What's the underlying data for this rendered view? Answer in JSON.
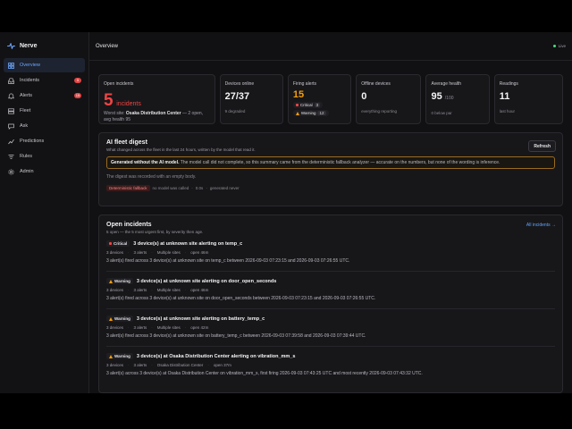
{
  "app": {
    "name": "Nerve"
  },
  "sidebar": {
    "items": [
      {
        "label": "Overview",
        "icon": "grid-icon",
        "active": true,
        "badge": ""
      },
      {
        "label": "Incidents",
        "icon": "inbox-icon",
        "active": false,
        "badge": "5"
      },
      {
        "label": "Alerts",
        "icon": "bell-icon",
        "active": false,
        "badge": "15"
      },
      {
        "label": "Fleet",
        "icon": "server-icon",
        "active": false,
        "badge": ""
      },
      {
        "label": "Ask",
        "icon": "chat-icon",
        "active": false,
        "badge": ""
      },
      {
        "label": "Predictions",
        "icon": "trend-icon",
        "active": false,
        "badge": ""
      },
      {
        "label": "Rules",
        "icon": "rules-icon",
        "active": false,
        "badge": ""
      },
      {
        "label": "Admin",
        "icon": "gear-icon",
        "active": false,
        "badge": ""
      }
    ]
  },
  "header": {
    "title": "Overview",
    "live_label": "Live"
  },
  "stats": {
    "open_incidents": {
      "label": "Open incidents",
      "value": "5",
      "word": "incidents",
      "worst_prefix": "Worst site: ",
      "worst_site": "Osaka Distribution Center",
      "worst_suffix": " — 2 open,",
      "worst_line2": "avg health 95"
    },
    "devices_online": {
      "label": "Devices online",
      "value": "27/37",
      "sub": "9 degraded"
    },
    "firing_alerts": {
      "label": "Firing alerts",
      "value": "15",
      "critical_label": "Critical",
      "critical_count": "3",
      "warning_label": "Warning",
      "warning_count": "12"
    },
    "offline_devices": {
      "label": "Offline devices",
      "value": "0",
      "sub": "everything reporting"
    },
    "average_health": {
      "label": "Average health",
      "value": "95",
      "unit": "/100",
      "sub": "0 below par"
    },
    "readings": {
      "label": "Readings",
      "value": "11",
      "sub": "last hour"
    }
  },
  "digest": {
    "title": "AI fleet digest",
    "subtitle": "What changed across the fleet in the last 24 hours, written by the model that read it.",
    "refresh_label": "Refresh",
    "warning_bold": "Generated without the AI model.",
    "warning_text": " The model call did not complete, so this summary came from the deterministic fallback analyzer — accurate on the numbers, but none of the wording is inference.",
    "note": "The digest was recorded with an empty body.",
    "meta_fallback": "Deterministic fallback",
    "meta_model": "no model was called",
    "meta_time": "0.0s",
    "meta_generated": "generated never"
  },
  "open_incidents": {
    "title": "Open incidents",
    "subtitle": "5 open — the 5 most urgent first, by severity then age.",
    "all_link": "All incidents →",
    "rows": [
      {
        "severity": "Critical",
        "title": "3 device(s) at unknown site alerting on temp_c",
        "devices": "3 devices",
        "alerts": "3 alerts",
        "site": "Multiple sites",
        "open": "open 46m",
        "desc": "3 alert(s) fired across 3 device(s) at unknown site on temp_c between 2026-09-03 07:23:15 and 2026-09-03 07:26:55 UTC."
      },
      {
        "severity": "Warning",
        "title": "3 device(s) at unknown site alerting on door_open_seconds",
        "devices": "3 devices",
        "alerts": "3 alerts",
        "site": "Multiple sites",
        "open": "open 46m",
        "desc": "3 alert(s) fired across 3 device(s) at unknown site on door_open_seconds between 2026-09-03 07:23:15 and 2026-09-03 07:26:55 UTC."
      },
      {
        "severity": "Warning",
        "title": "3 device(s) at unknown site alerting on battery_temp_c",
        "devices": "3 devices",
        "alerts": "3 alerts",
        "site": "Multiple sites",
        "open": "open 42m",
        "desc": "3 alert(s) fired across 3 device(s) at unknown site on battery_temp_c between 2026-09-03 07:39:58 and 2026-09-03 07:39:44 UTC."
      },
      {
        "severity": "Warning",
        "title": "3 device(s) at Osaka Distribution Center alerting on vibration_mm_s",
        "devices": "3 devices",
        "alerts": "3 alerts",
        "site": "Osaka Distribution Center",
        "open": "open 37m",
        "desc": "3 alert(s) across 3 device(s) at Osaka Distribution Center on vibration_mm_s, first firing 2026-09-03 07:43:25 UTC and most recently 2026-09-03 07:43:32 UTC."
      }
    ]
  },
  "colors": {
    "accent": "#60a5fa",
    "critical": "#ef4444",
    "warning": "#f59e0b",
    "background": "#111113"
  }
}
